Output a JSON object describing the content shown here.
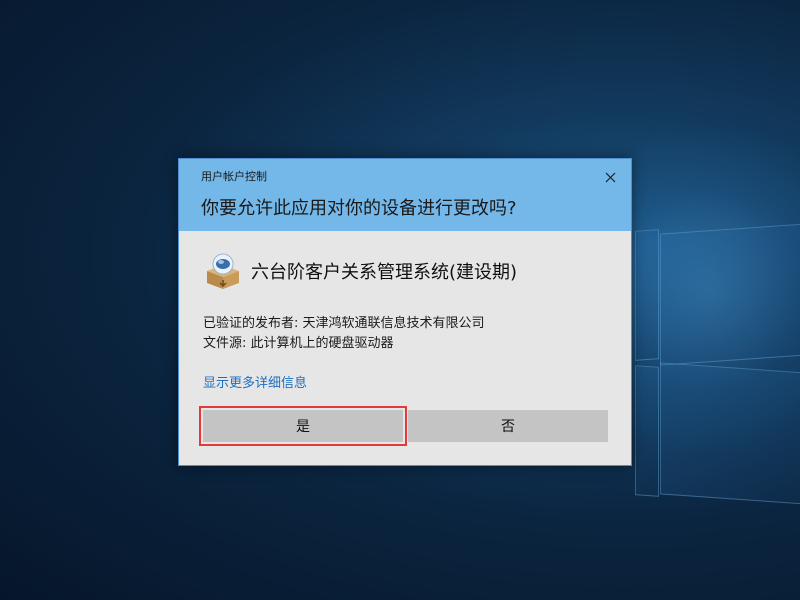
{
  "dialog": {
    "window_title": "用户帐户控制",
    "question": "你要允许此应用对你的设备进行更改吗?",
    "close_icon": "close-icon",
    "app_icon": "installer-box-icon",
    "app_name": "六台阶客户关系管理系统(建设期)",
    "publisher_line": "已验证的发布者: 天津鸿软通联信息技术有限公司",
    "source_line": "文件源: 此计算机上的硬盘驱动器",
    "details_link": "显示更多详细信息",
    "yes_label": "是",
    "no_label": "否"
  },
  "colors": {
    "header_bg": "#74b7e9",
    "body_bg": "#e6e6e6",
    "button_bg": "#c4c4c4",
    "link": "#1d6fbf",
    "highlight_outline": "#e23b3b"
  }
}
